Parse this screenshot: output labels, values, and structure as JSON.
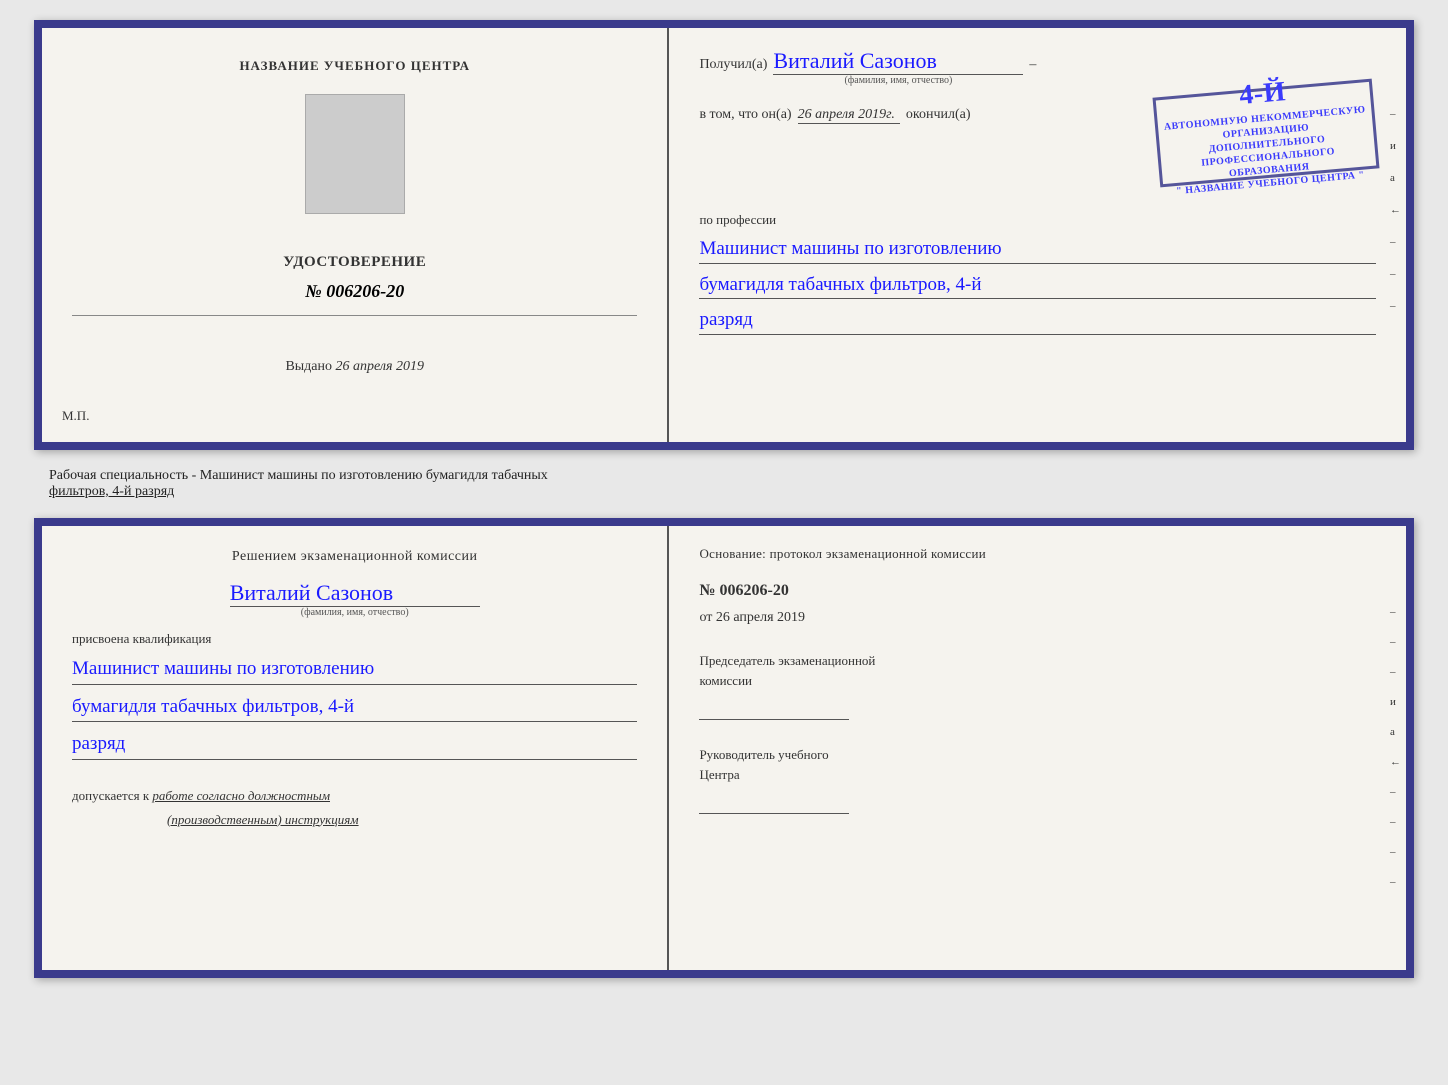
{
  "topDoc": {
    "left": {
      "centerNameLabel": "НАЗВАНИЕ УЧЕБНОГО ЦЕНТРА",
      "udostoverenie": "УДОСТОВЕРЕНИЕ",
      "number": "№ 006206-20",
      "issuedLabel": "Выдано",
      "issuedDate": "26 апреля 2019",
      "mp": "М.П."
    },
    "right": {
      "recipientPrefix": "Получил(а)",
      "recipientName": "Виталий Сазонов",
      "recipientSubtitle": "(фамилия, имя, отчество)",
      "dash": "–",
      "completedPrefix": "в том, что он(а)",
      "completedDate": "26 апреля 2019г.",
      "completedWord": "окончил(а)",
      "stamp": {
        "line1": "4-й",
        "line2": "АВТОНОМНУЮ НЕКОММЕРЧЕСКУЮ ОРГАНИЗАЦИЮ",
        "line3": "ДОПОЛНИТЕЛЬНОГО ПРОФЕССИОНАЛЬНОГО ОБРАЗОВАНИЯ",
        "line4": "\" НАЗВАНИЕ УЧЕБНОГО ЦЕНТРА \""
      },
      "professionLabel": "по профессии",
      "professionLine1": "Машинист машины по изготовлению",
      "professionLine2": "бумагидля табачных фильтров, 4-й",
      "professionLine3": "разряд"
    },
    "sideMarks": [
      "–",
      "и",
      "а",
      "←",
      "–",
      "–",
      "–",
      "–"
    ]
  },
  "middleText": {
    "line1": "Рабочая специальность - Машинист машины по изготовлению бумагидля табачных",
    "line2": "фильтров, 4-й разряд"
  },
  "bottomDoc": {
    "left": {
      "komissiaTitle": "Решением  экзаменационной  комиссии",
      "name": "Виталий Сазонов",
      "fioSubtitle": "(фамилия, имя, отчество)",
      "prisvoenaLabel": "присвоена квалификация",
      "profLine1": "Машинист машины по изготовлению",
      "profLine2": "бумагидля табачных фильтров, 4-й",
      "profLine3": "разряд",
      "dopuskaetsyaLabel": "допускается к",
      "dopuskaetsyaText": "работе согласно должностным",
      "dopuskaetsyaText2": "(производственным) инструкциям"
    },
    "right": {
      "osnovanieTitle": "Основание: протокол экзаменационной  комиссии",
      "protocolNumber": "№  006206-20",
      "otLabel": "от",
      "date": "26 апреля 2019",
      "predsedatelLabel": "Председатель экзаменационной",
      "predsedatelLabel2": "комиссии",
      "rukovoditelLabel": "Руководитель учебного",
      "rukovoditelLabel2": "Центра"
    },
    "sideMarks": [
      "–",
      "–",
      "–",
      "и",
      "а",
      "←",
      "–",
      "–",
      "–",
      "–",
      "–"
    ]
  }
}
